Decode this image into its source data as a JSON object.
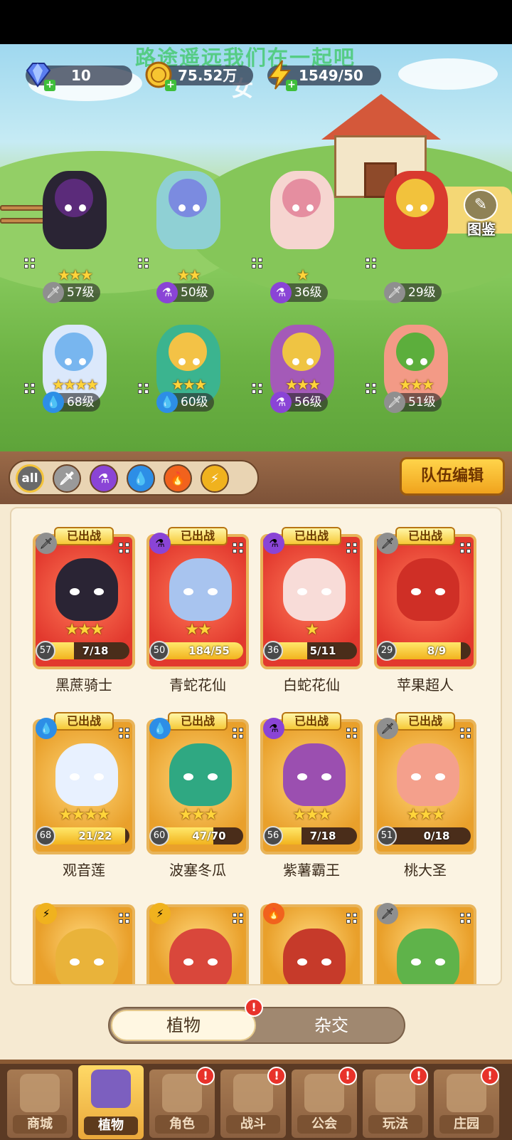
{
  "resources": {
    "gems": "10",
    "gold": "75.52万",
    "energy": "1549/50"
  },
  "banner_text": "路途遥远我们在一起吧",
  "banner_sub": "女",
  "tujian_label": "图鉴",
  "lineup": [
    {
      "name": "黑蔗骑士",
      "stars": "★★★",
      "level": "57级",
      "element": "sword",
      "color": "#2a2434",
      "accent": "#5b2b7a"
    },
    {
      "name": "青蛇花仙",
      "stars": "★★",
      "level": "50级",
      "element": "potion",
      "color": "#8fd0d4",
      "accent": "#7b8be0"
    },
    {
      "name": "白蛇花仙",
      "stars": "★",
      "level": "36级",
      "element": "potion",
      "color": "#f6d5d0",
      "accent": "#e58ea0"
    },
    {
      "name": "苹果超人",
      "stars": "",
      "level": "29级",
      "element": "sword",
      "color": "#d93a2e",
      "accent": "#f2c23c"
    },
    {
      "name": "观音莲",
      "stars": "★★★★",
      "level": "68级",
      "element": "water",
      "color": "#dbe8fb",
      "accent": "#78b6ef"
    },
    {
      "name": "波塞冬瓜",
      "stars": "★★★",
      "level": "60级",
      "element": "water",
      "color": "#3bb48f",
      "accent": "#f3c246"
    },
    {
      "name": "紫薯霸王",
      "stars": "★★★",
      "level": "56级",
      "element": "potion",
      "color": "#a45ab8",
      "accent": "#efc443"
    },
    {
      "name": "桃大圣",
      "stars": "★★★",
      "level": "51级",
      "element": "sword",
      "color": "#f39a86",
      "accent": "#5cae3c"
    }
  ],
  "filters": {
    "all_label": "all"
  },
  "team_edit_label": "队伍编辑",
  "deployed_tag": "已出战",
  "cards": [
    {
      "name": "黑蔗骑士",
      "level": "57",
      "count": "7/18",
      "progress": 0.39,
      "stars": "★★★",
      "element": "sword",
      "frame": "red",
      "color": "#2a2434"
    },
    {
      "name": "青蛇花仙",
      "level": "50",
      "count": "184/55",
      "progress": 1.0,
      "stars": "★★",
      "element": "potion",
      "frame": "red",
      "color": "#a8c4ef"
    },
    {
      "name": "白蛇花仙",
      "level": "36",
      "count": "5/11",
      "progress": 0.45,
      "stars": "★",
      "element": "potion",
      "frame": "red",
      "color": "#f8dcd8"
    },
    {
      "name": "苹果超人",
      "level": "29",
      "count": "8/9",
      "progress": 0.89,
      "stars": "",
      "element": "sword",
      "frame": "red",
      "color": "#cf2f26"
    },
    {
      "name": "观音莲",
      "level": "68",
      "count": "21/22",
      "progress": 0.95,
      "stars": "★★★★",
      "element": "water",
      "frame": "gold",
      "color": "#e8f1ff"
    },
    {
      "name": "波塞冬瓜",
      "level": "60",
      "count": "47/70",
      "progress": 0.67,
      "stars": "★★★",
      "element": "water",
      "frame": "gold",
      "color": "#2fa882"
    },
    {
      "name": "紫薯霸王",
      "level": "56",
      "count": "7/18",
      "progress": 0.39,
      "stars": "★★★",
      "element": "potion",
      "frame": "gold",
      "color": "#9b4fb0"
    },
    {
      "name": "桃大圣",
      "level": "51",
      "count": "0/18",
      "progress": 0.0,
      "stars": "★★★",
      "element": "sword",
      "frame": "gold",
      "color": "#f4a08c"
    },
    {
      "element": "lightning",
      "frame": "gold",
      "color": "#e9b33a"
    },
    {
      "element": "lightning",
      "frame": "gold",
      "color": "#d9473b"
    },
    {
      "element": "fire",
      "frame": "gold",
      "color": "#c63a2a"
    },
    {
      "element": "sword",
      "frame": "gold",
      "color": "#5fb34a"
    }
  ],
  "toggle": {
    "plants": "植物",
    "hybrid": "杂交"
  },
  "nav": [
    {
      "label": "商城",
      "badge": ""
    },
    {
      "label": "植物",
      "badge": ""
    },
    {
      "label": "角色",
      "badge": "!"
    },
    {
      "label": "战斗",
      "badge": "!"
    },
    {
      "label": "公会",
      "badge": "!"
    },
    {
      "label": "玩法",
      "badge": "!"
    },
    {
      "label": "庄园",
      "badge": "!"
    }
  ],
  "colors": {
    "sword": "#8f8f8f",
    "potion": "#8a44d6",
    "water": "#2d8ee6",
    "fire": "#f1621d",
    "lightning": "#f0b21e"
  }
}
